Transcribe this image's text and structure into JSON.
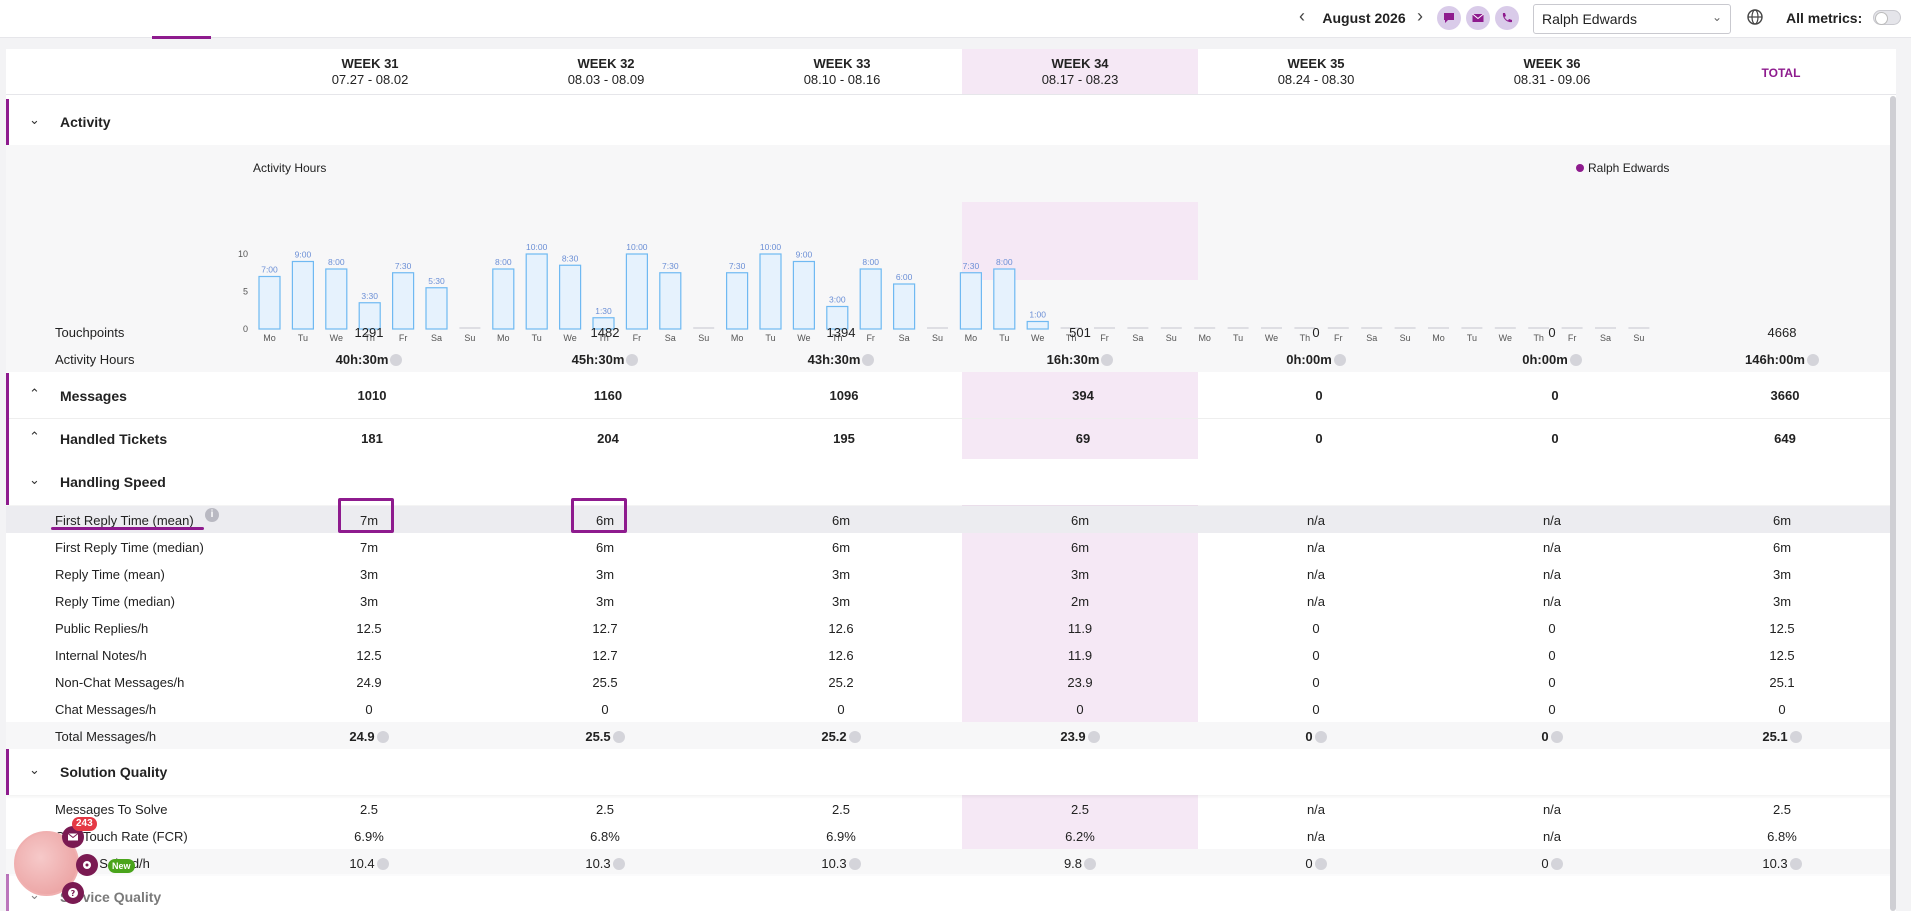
{
  "toolbar": {
    "prev_icon": "‹",
    "next_icon": "›",
    "month": "August 2026",
    "agent": "Ralph Edwards",
    "all_metrics_label": "All metrics:"
  },
  "weeks": [
    {
      "name": "WEEK 31",
      "range": "07.27 - 08.02"
    },
    {
      "name": "WEEK 32",
      "range": "08.03 - 08.09"
    },
    {
      "name": "WEEK 33",
      "range": "08.10 - 08.16"
    },
    {
      "name": "WEEK 34",
      "range": "08.17 - 08.23"
    },
    {
      "name": "WEEK 35",
      "range": "08.24 - 08.30"
    },
    {
      "name": "WEEK 36",
      "range": "08.31 - 09.06"
    }
  ],
  "total_label": "TOTAL",
  "sections": {
    "activity": {
      "title": "Activity",
      "touchpoints": {
        "label": "Touchpoints",
        "values": [
          "1291",
          "1482",
          "1394",
          "501",
          "0",
          "0",
          "4668"
        ]
      },
      "activity_hours": {
        "label": "Activity Hours",
        "values": [
          "40h:30m",
          "45h:30m",
          "43h:30m",
          "16h:30m",
          "0h:00m",
          "0h:00m",
          "146h:00m"
        ]
      }
    },
    "messages": {
      "title": "Messages",
      "values": [
        "1010",
        "1160",
        "1096",
        "394",
        "0",
        "0",
        "3660"
      ]
    },
    "handled_tickets": {
      "title": "Handled Tickets",
      "values": [
        "181",
        "204",
        "195",
        "69",
        "0",
        "0",
        "649"
      ]
    },
    "handling_speed": {
      "title": "Handling Speed",
      "rows": [
        {
          "label": "First Reply Time (mean)",
          "values": [
            "7m",
            "6m",
            "6m",
            "6m",
            "n/a",
            "n/a",
            "6m"
          ]
        },
        {
          "label": "First Reply Time (median)",
          "values": [
            "7m",
            "6m",
            "6m",
            "6m",
            "n/a",
            "n/a",
            "6m"
          ]
        },
        {
          "label": "Reply Time (mean)",
          "values": [
            "3m",
            "3m",
            "3m",
            "3m",
            "n/a",
            "n/a",
            "3m"
          ]
        },
        {
          "label": "Reply Time (median)",
          "values": [
            "3m",
            "3m",
            "3m",
            "2m",
            "n/a",
            "n/a",
            "3m"
          ]
        },
        {
          "label": "Public Replies/h",
          "values": [
            "12.5",
            "12.7",
            "12.6",
            "11.9",
            "0",
            "0",
            "12.5"
          ]
        },
        {
          "label": "Internal Notes/h",
          "values": [
            "12.5",
            "12.7",
            "12.6",
            "11.9",
            "0",
            "0",
            "12.5"
          ]
        },
        {
          "label": "Non-Chat Messages/h",
          "values": [
            "24.9",
            "25.5",
            "25.2",
            "23.9",
            "0",
            "0",
            "25.1"
          ]
        },
        {
          "label": "Chat Messages/h",
          "values": [
            "0",
            "0",
            "0",
            "0",
            "0",
            "0",
            "0"
          ]
        },
        {
          "label": "Total Messages/h",
          "values": [
            "24.9",
            "25.5",
            "25.2",
            "23.9",
            "0",
            "0",
            "25.1"
          ]
        }
      ]
    },
    "solution_quality": {
      "title": "Solution Quality",
      "rows": [
        {
          "label": "Messages To Solve",
          "values": [
            "2.5",
            "2.5",
            "2.5",
            "2.5",
            "n/a",
            "n/a",
            "2.5"
          ]
        },
        {
          "label": "One Touch Rate (FCR)",
          "values": [
            "6.9%",
            "6.8%",
            "6.9%",
            "6.2%",
            "n/a",
            "n/a",
            "6.8%"
          ]
        },
        {
          "label": "Tickets Solved/h",
          "values": [
            "10.4",
            "10.3",
            "10.3",
            "9.8",
            "0",
            "0",
            "10.3"
          ]
        }
      ]
    },
    "service_quality": {
      "title": "Service Quality"
    }
  },
  "chart_data": {
    "type": "bar",
    "title": "Activity Hours",
    "legend": [
      "Ralph Edwards"
    ],
    "legend_position": "top-right",
    "ylim": [
      0,
      10
    ],
    "yticks": [
      "0",
      "5",
      "10"
    ],
    "categories": [
      "Mo",
      "Tu",
      "We",
      "Th",
      "Fr",
      "Sa",
      "Su",
      "Mo",
      "Tu",
      "We",
      "Th",
      "Fr",
      "Sa",
      "Su",
      "Mo",
      "Tu",
      "We",
      "Th",
      "Fr",
      "Sa",
      "Su",
      "Mo",
      "Tu",
      "We",
      "Th",
      "Fr",
      "Sa",
      "Su",
      "Mo",
      "Tu",
      "We",
      "Th",
      "Fr",
      "Sa",
      "Su",
      "Mo",
      "Tu",
      "We",
      "Th",
      "Fr",
      "Sa",
      "Su"
    ],
    "values": [
      7,
      9,
      8,
      3.5,
      7.5,
      5.5,
      0,
      8,
      10,
      8.5,
      1.5,
      10,
      7.5,
      0,
      7.5,
      10,
      9,
      3,
      8,
      6,
      0,
      7.5,
      8,
      1,
      0,
      0,
      0,
      0,
      0,
      0,
      0,
      0,
      0,
      0,
      0,
      0,
      0,
      0,
      0,
      0,
      0,
      0
    ],
    "data_labels": [
      "7:00",
      "9:00",
      "8:00",
      "3:30",
      "7:30",
      "5:30",
      "",
      "8:00",
      "10:00",
      "8:30",
      "1:30",
      "10:00",
      "7:30",
      "",
      "7:30",
      "10:00",
      "9:00",
      "3:00",
      "8:00",
      "6:00",
      "",
      "7:30",
      "8:00",
      "1:00",
      "",
      "",
      "",
      "",
      "",
      "",
      "",
      "",
      "",
      "",
      "",
      "",
      "",
      "",
      "",
      "",
      "",
      ""
    ],
    "colors": {
      "bar_fill": "#e6f2fd",
      "bar_stroke": "#6fb9f2",
      "label": "#6b8fd6",
      "accent": "#8e1b8e",
      "highlight": "#f5e8f5"
    }
  },
  "widget": {
    "badge": "243",
    "new_label": "New"
  }
}
